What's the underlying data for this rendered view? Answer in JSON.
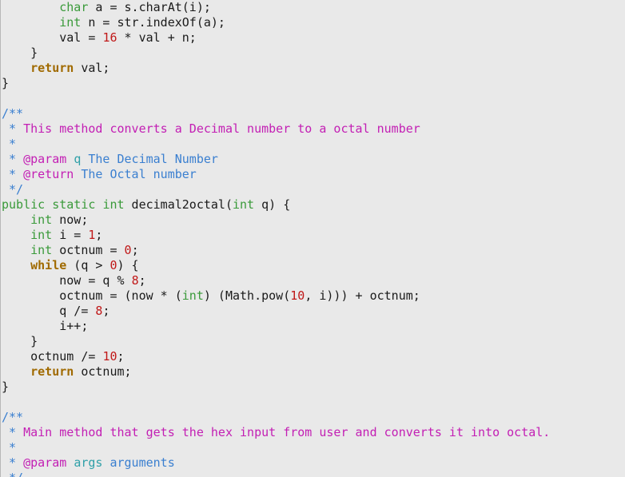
{
  "editor": {
    "lines": [
      [
        {
          "t": "        ",
          "c": "plain"
        },
        {
          "t": "char",
          "c": "type"
        },
        {
          "t": " a = s.charAt(i);",
          "c": "plain"
        }
      ],
      [
        {
          "t": "        ",
          "c": "plain"
        },
        {
          "t": "int",
          "c": "type"
        },
        {
          "t": " n = str.indexOf(a);",
          "c": "plain"
        }
      ],
      [
        {
          "t": "        val = ",
          "c": "plain"
        },
        {
          "t": "16",
          "c": "number"
        },
        {
          "t": " * val + n;",
          "c": "plain"
        }
      ],
      [
        {
          "t": "    }",
          "c": "plain"
        }
      ],
      [
        {
          "t": "    ",
          "c": "plain"
        },
        {
          "t": "return",
          "c": "keyword"
        },
        {
          "t": " val;",
          "c": "plain"
        }
      ],
      [
        {
          "t": "}",
          "c": "plain"
        }
      ],
      [],
      [
        {
          "t": "/**",
          "c": "comment"
        }
      ],
      [
        {
          "t": " * ",
          "c": "comment"
        },
        {
          "t": "This method converts a Decimal number to a octal number",
          "c": "doc-text"
        }
      ],
      [
        {
          "t": " *",
          "c": "comment"
        }
      ],
      [
        {
          "t": " * ",
          "c": "comment"
        },
        {
          "t": "@param",
          "c": "doc-tag"
        },
        {
          "t": " ",
          "c": "comment"
        },
        {
          "t": "q",
          "c": "doc-param"
        },
        {
          "t": " The Decimal Number",
          "c": "doc-desc"
        }
      ],
      [
        {
          "t": " * ",
          "c": "comment"
        },
        {
          "t": "@return",
          "c": "doc-tag"
        },
        {
          "t": " The Octal number",
          "c": "doc-desc"
        }
      ],
      [
        {
          "t": " */",
          "c": "comment"
        }
      ],
      [
        {
          "t": "public",
          "c": "type"
        },
        {
          "t": " ",
          "c": "plain"
        },
        {
          "t": "static",
          "c": "type"
        },
        {
          "t": " ",
          "c": "plain"
        },
        {
          "t": "int",
          "c": "type"
        },
        {
          "t": " decimal2octal(",
          "c": "plain"
        },
        {
          "t": "int",
          "c": "type"
        },
        {
          "t": " q) {",
          "c": "plain"
        }
      ],
      [
        {
          "t": "    ",
          "c": "plain"
        },
        {
          "t": "int",
          "c": "type"
        },
        {
          "t": " now;",
          "c": "plain"
        }
      ],
      [
        {
          "t": "    ",
          "c": "plain"
        },
        {
          "t": "int",
          "c": "type"
        },
        {
          "t": " i = ",
          "c": "plain"
        },
        {
          "t": "1",
          "c": "number"
        },
        {
          "t": ";",
          "c": "plain"
        }
      ],
      [
        {
          "t": "    ",
          "c": "plain"
        },
        {
          "t": "int",
          "c": "type"
        },
        {
          "t": " octnum = ",
          "c": "plain"
        },
        {
          "t": "0",
          "c": "number"
        },
        {
          "t": ";",
          "c": "plain"
        }
      ],
      [
        {
          "t": "    ",
          "c": "plain"
        },
        {
          "t": "while",
          "c": "keyword"
        },
        {
          "t": " (q > ",
          "c": "plain"
        },
        {
          "t": "0",
          "c": "number"
        },
        {
          "t": ") {",
          "c": "plain"
        }
      ],
      [
        {
          "t": "        now = q % ",
          "c": "plain"
        },
        {
          "t": "8",
          "c": "number"
        },
        {
          "t": ";",
          "c": "plain"
        }
      ],
      [
        {
          "t": "        octnum = (now * (",
          "c": "plain"
        },
        {
          "t": "int",
          "c": "type"
        },
        {
          "t": ") (Math.pow(",
          "c": "plain"
        },
        {
          "t": "10",
          "c": "number"
        },
        {
          "t": ", i))) + octnum;",
          "c": "plain"
        }
      ],
      [
        {
          "t": "        q /= ",
          "c": "plain"
        },
        {
          "t": "8",
          "c": "number"
        },
        {
          "t": ";",
          "c": "plain"
        }
      ],
      [
        {
          "t": "        i++;",
          "c": "plain"
        }
      ],
      [
        {
          "t": "    }",
          "c": "plain"
        }
      ],
      [
        {
          "t": "    octnum /= ",
          "c": "plain"
        },
        {
          "t": "10",
          "c": "number"
        },
        {
          "t": ";",
          "c": "plain"
        }
      ],
      [
        {
          "t": "    ",
          "c": "plain"
        },
        {
          "t": "return",
          "c": "keyword"
        },
        {
          "t": " octnum;",
          "c": "plain"
        }
      ],
      [
        {
          "t": "}",
          "c": "plain"
        }
      ],
      [],
      [
        {
          "t": "/**",
          "c": "comment"
        }
      ],
      [
        {
          "t": " * ",
          "c": "comment"
        },
        {
          "t": "Main method that gets the hex input from user and converts it into octal.",
          "c": "doc-text"
        }
      ],
      [
        {
          "t": " *",
          "c": "comment"
        }
      ],
      [
        {
          "t": " * ",
          "c": "comment"
        },
        {
          "t": "@param",
          "c": "doc-tag"
        },
        {
          "t": " ",
          "c": "comment"
        },
        {
          "t": "args",
          "c": "doc-param"
        },
        {
          "t": " arguments",
          "c": "doc-desc"
        }
      ],
      [
        {
          "t": " */",
          "c": "comment"
        }
      ]
    ]
  }
}
